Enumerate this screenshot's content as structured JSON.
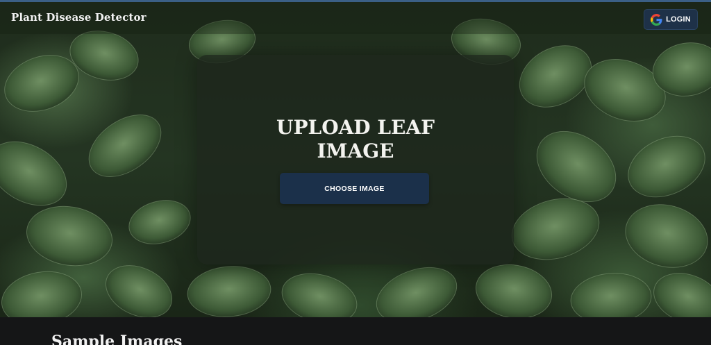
{
  "navbar": {
    "brand": "Plant Disease Detector",
    "login_label": "LOGIN",
    "login_icon": "google-g-icon"
  },
  "upload": {
    "title_line1": "UPLOAD LEAF",
    "title_line2": "IMAGE",
    "choose_label": "CHOOSE IMAGE"
  },
  "samples": {
    "title": "Sample Images"
  },
  "colors": {
    "accent": "#1b304a",
    "login_bg": "#1e3148",
    "page_bg": "#151617",
    "card_bg": "rgba(30,38,28,0.78)"
  }
}
